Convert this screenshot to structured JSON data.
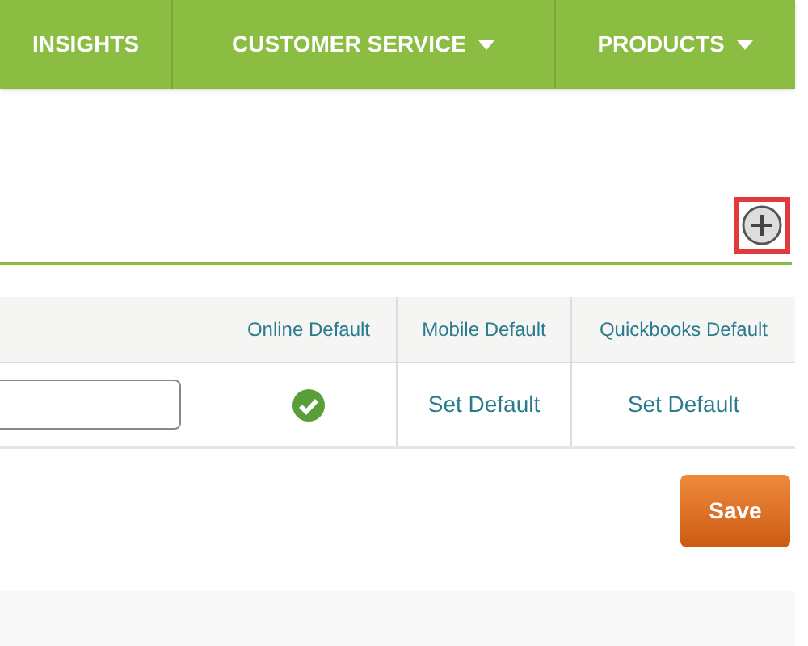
{
  "nav": {
    "items": [
      {
        "label": "INSIGHTS",
        "dropdown": false
      },
      {
        "label": "CUSTOMER SERVICE",
        "dropdown": true
      },
      {
        "label": "PRODUCTS",
        "dropdown": true
      }
    ]
  },
  "table": {
    "columns": [
      "Online Default",
      "Mobile Default",
      "Quickbooks Default"
    ],
    "rows": [
      {
        "cells": [
          {
            "kind": "check"
          },
          {
            "kind": "link",
            "text": "Set Default"
          },
          {
            "kind": "link",
            "text": "Set Default"
          }
        ]
      }
    ]
  },
  "save_button": "Save"
}
